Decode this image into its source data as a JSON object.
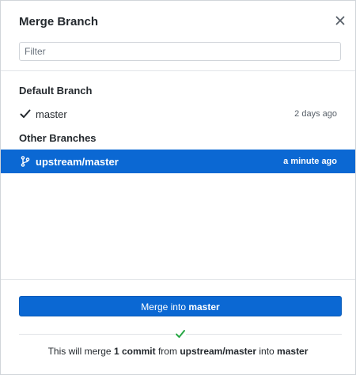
{
  "dialog": {
    "title": "Merge Branch"
  },
  "filter": {
    "placeholder": "Filter",
    "value": ""
  },
  "sections": {
    "default_label": "Default Branch",
    "other_label": "Other Branches"
  },
  "branches": {
    "default": [
      {
        "name": "master",
        "time": "2 days ago",
        "current": true
      }
    ],
    "other": [
      {
        "name": "upstream/master",
        "time": "a minute ago",
        "selected": true
      }
    ]
  },
  "merge_button": {
    "prefix": "Merge into ",
    "target": "master"
  },
  "summary": {
    "part1": "This will merge ",
    "count": "1 commit",
    "part2": " from ",
    "source": "upstream/master",
    "part3": " into ",
    "target": "master"
  },
  "colors": {
    "accent": "#0b68d3",
    "success": "#28a745"
  },
  "icons": {
    "close": "close-icon",
    "check": "checkmark-icon",
    "branch": "git-branch-icon",
    "status": "success-check-icon"
  }
}
